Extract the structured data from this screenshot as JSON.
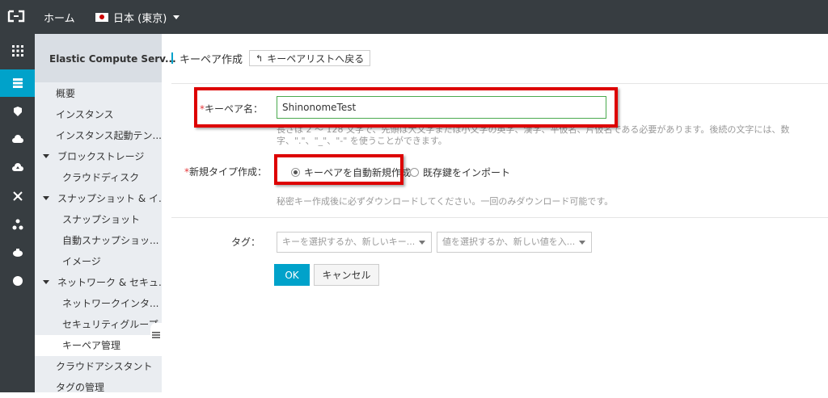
{
  "topbar": {
    "home_label": "ホーム",
    "region_label": "日本 (東京)"
  },
  "rail": {
    "items": [
      "apps-icon",
      "ecs-icon",
      "network-icon",
      "cloud-icon",
      "cloud-upload-icon",
      "nodes-icon",
      "cluster-icon",
      "database-icon",
      "circle-icon"
    ]
  },
  "sidebar": {
    "title": "Elastic Compute Serv...",
    "items": [
      {
        "label": "概要"
      },
      {
        "label": "インスタンス"
      },
      {
        "label": "インスタンス起動テン..."
      },
      {
        "label": "ブロックストレージ"
      },
      {
        "label": "クラウドディスク"
      },
      {
        "label": "スナップショット & イ..."
      },
      {
        "label": "スナップショット"
      },
      {
        "label": "自動スナップショッ..."
      },
      {
        "label": "イメージ"
      },
      {
        "label": "ネットワーク & セキュ..."
      },
      {
        "label": "ネットワークインタ..."
      },
      {
        "label": "セキュリティグループ"
      },
      {
        "label": "キーペア管理"
      },
      {
        "label": "クラウドアシスタント"
      },
      {
        "label": "タグの管理"
      }
    ]
  },
  "main": {
    "title": "キーペア作成",
    "back_label": "キーペアリストへ戻る",
    "form": {
      "name_label": "キーペア名：",
      "name_value": "ShinonomeTest",
      "name_help_1": "長さは 2 ～ 128 文字で、先頭は大文字または小文字の英字、漢字、平仮名、片仮名である必要があります。後続の文字には、数",
      "name_help_2": "字、\".\"、\"_\"、\"-\" を使うことができます。",
      "type_label": "新規タイプ作成：",
      "radio_auto": "キーペアを自動新規作成",
      "radio_import": "既存鍵をインポート",
      "type_help": "秘密キー作成後に必ずダウンロードしてください。一回のみダウンロード可能です。",
      "tag_label": "タグ：",
      "tag_key_placeholder": "キーを選択するか、新しいキー...",
      "tag_value_placeholder": "値を選択するか、新しい値を入...",
      "ok_label": "OK",
      "cancel_label": "キャンセル"
    }
  },
  "colors": {
    "topbar": "#373d41",
    "accent": "#00a2ca",
    "highlight": "#dd0000",
    "required": "#e4393c"
  }
}
